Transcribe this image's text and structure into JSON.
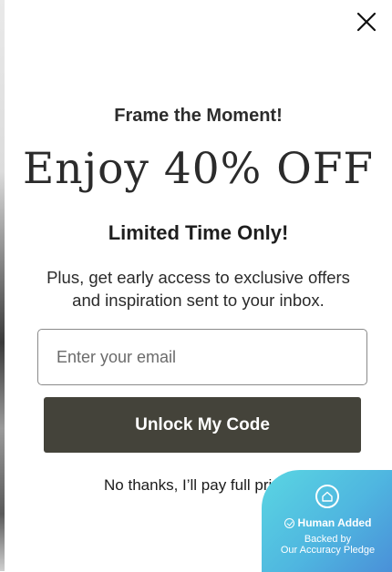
{
  "modal": {
    "eyebrow": "Frame the Moment!",
    "headline": "Enjoy 40% OFF",
    "subhead": "Limited Time Only!",
    "body": "Plus, get early access to exclusive offers and inspiration sent to your inbox.",
    "email": {
      "placeholder": "Enter your email",
      "value": ""
    },
    "cta_label": "Unlock My Code",
    "decline_label": "No thanks, I’ll pay full price.",
    "close_icon": "close-icon"
  },
  "badge": {
    "icon": "house-icon",
    "title": "Human Added",
    "line1": "Backed by",
    "line2": "Our Accuracy Pledge",
    "colors": {
      "start": "#5ad6e2",
      "end": "#4a8fd8"
    }
  },
  "colors": {
    "cta_background": "#44433a",
    "text": "#2b2b2b"
  }
}
